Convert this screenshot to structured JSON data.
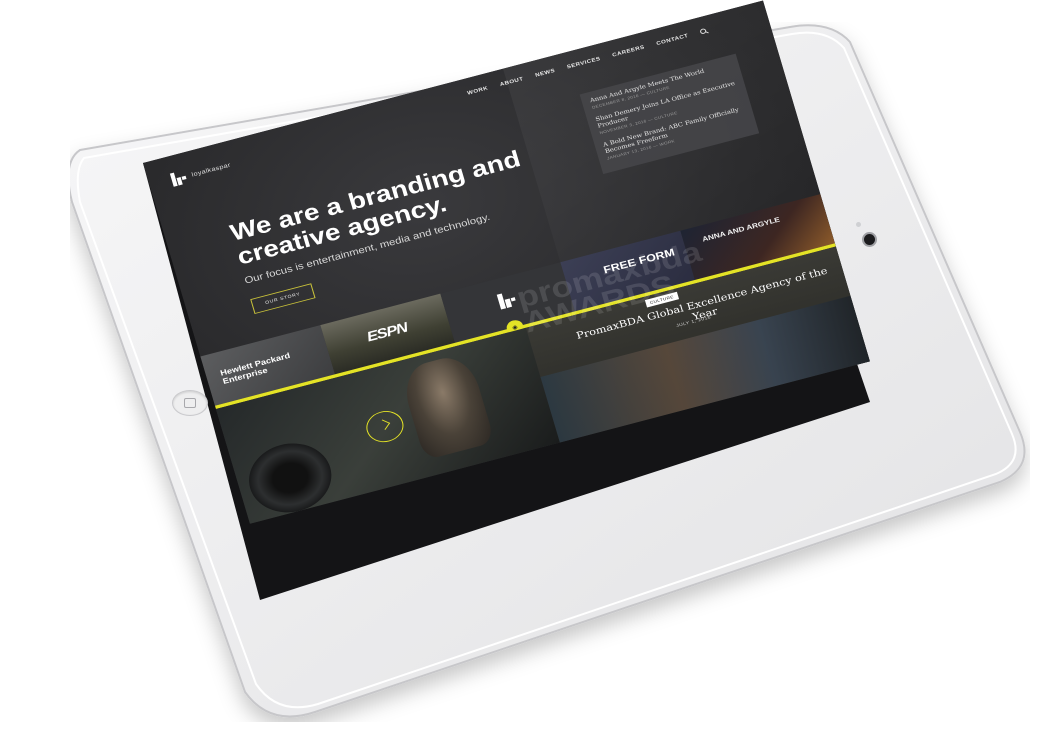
{
  "site": {
    "logo_text": "loyalkaspar"
  },
  "nav": {
    "items": [
      "WORK",
      "ABOUT",
      "NEWS",
      "SERVICES",
      "CAREERS",
      "CONTACT"
    ]
  },
  "news": [
    {
      "title": "Anna And Argyle Meets The World",
      "meta": "DECEMBER 8, 2016 — CULTURE"
    },
    {
      "title": "Shan Demery Joins LA Office as Executive Producer",
      "meta": "NOVEMBER 3, 2016 — CULTURE"
    },
    {
      "title": "A Bold New Brand: ABC Family Officially Becomes Freeform",
      "meta": "JANUARY 13, 2016 — WORK"
    }
  ],
  "hero": {
    "headline": "We are a branding and creative agency.",
    "subline": "Our focus is entertainment, media and technology.",
    "button": "OUR STORY"
  },
  "tiles": {
    "hp": "Hewlett Packard Enterprise",
    "espn": "ESPN",
    "freeform": "FREE FORM",
    "anna": "ANNA AND ARGYLE"
  },
  "feature": {
    "tag": "CULTURE",
    "title": "PromaxBDA Global Excellence Agency of the Year",
    "date": "JULY 1, 2016",
    "bg_text": "promaxbda AWARDS"
  },
  "colors": {
    "accent": "#e4e326",
    "dark_bg": "#2b2b2d"
  }
}
